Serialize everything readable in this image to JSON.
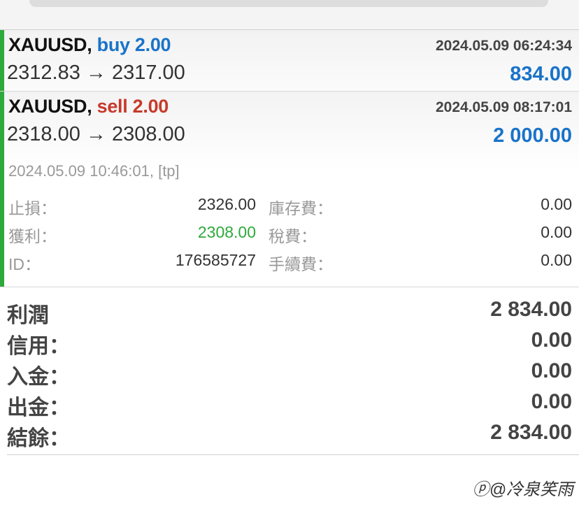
{
  "trades": [
    {
      "symbol": "XAUUSD,",
      "side": "buy 2.00",
      "time": "2024.05.09 06:24:34",
      "prices": "2312.83 → 2317.00",
      "profit": "834.00"
    },
    {
      "symbol": "XAUUSD,",
      "side": "sell 2.00",
      "time": "2024.05.09 08:17:01",
      "prices": "2318.00 → 2308.00",
      "profit": "2 000.00",
      "close_info": "2024.05.09 10:46:01, [tp]",
      "details": {
        "sl_label": "止損：",
        "sl_value": "2326.00",
        "tp_label": "獲利：",
        "tp_value": "2308.00",
        "id_label": "ID：",
        "id_value": "176585727",
        "swap_label": "庫存費：",
        "swap_value": "0.00",
        "tax_label": "稅費：",
        "tax_value": "0.00",
        "fee_label": "手續費：",
        "fee_value": "0.00"
      }
    }
  ],
  "summary": {
    "profit_label": "利潤",
    "profit_value": "2 834.00",
    "credit_label": "信用：",
    "credit_value": "0.00",
    "deposit_label": "入金：",
    "deposit_value": "0.00",
    "withdrawal_label": "出金：",
    "withdrawal_value": "0.00",
    "balance_label": "結餘：",
    "balance_value": "2 834.00"
  },
  "watermark": "ⓟ@冷泉笑雨",
  "colors": {
    "buy": "#1a73c9",
    "sell": "#c73a2b",
    "profit": "#1a73c9",
    "accent_bar": "#2eaa3a"
  }
}
